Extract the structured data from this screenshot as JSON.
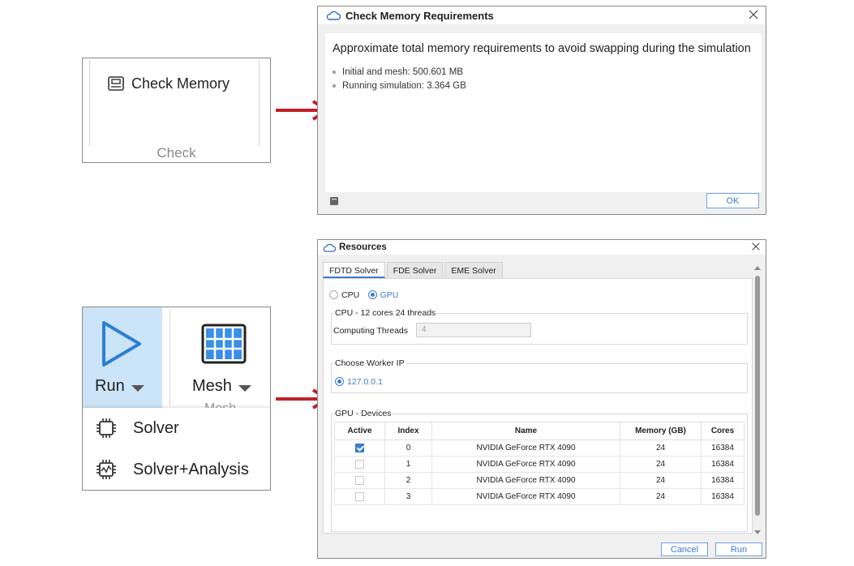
{
  "check_panel": {
    "button_label": "Check Memory",
    "group_label": "Check"
  },
  "memory_dialog": {
    "title": "Check Memory Requirements",
    "heading": "Approximate total memory requirements to avoid swapping during the simulation",
    "items": [
      "Initial and mesh: 500.601 MB",
      "Running simulation: 3.364 GB"
    ],
    "ok_label": "OK"
  },
  "run_panel": {
    "run_label": "Run",
    "mesh_label": "Mesh",
    "mesh_under_label": "Mesh",
    "menu": [
      "Solver",
      "Solver+Analysis"
    ]
  },
  "resources_dialog": {
    "title": "Resources",
    "tabs": [
      "FDTD Solver",
      "FDE Solver",
      "EME Solver"
    ],
    "active_tab": "FDTD Solver",
    "device_options": [
      "CPU",
      "GPU"
    ],
    "selected_device": "GPU",
    "cpu_group": "CPU - 12 cores 24 threads",
    "computing_threads_label": "Computing Threads",
    "computing_threads_value": "4",
    "worker_group": "Choose Worker IP",
    "worker_ip": "127.0.0.1",
    "gpu_group": "GPU - Devices",
    "table": {
      "headers": [
        "Active",
        "Index",
        "Name",
        "Memory (GB)",
        "Cores"
      ],
      "rows": [
        {
          "active": true,
          "index": "0",
          "name": "NVIDIA GeForce RTX 4090",
          "memory": "24",
          "cores": "16384"
        },
        {
          "active": false,
          "index": "1",
          "name": "NVIDIA GeForce RTX 4090",
          "memory": "24",
          "cores": "16384"
        },
        {
          "active": false,
          "index": "2",
          "name": "NVIDIA GeForce RTX 4090",
          "memory": "24",
          "cores": "16384"
        },
        {
          "active": false,
          "index": "3",
          "name": "NVIDIA GeForce RTX 4090",
          "memory": "24",
          "cores": "16384"
        }
      ]
    },
    "cancel_label": "Cancel",
    "run_label": "Run"
  },
  "colors": {
    "accent": "#3b7bd4",
    "arrow": "#c0202a",
    "run_highlight": "#cce4f7"
  }
}
